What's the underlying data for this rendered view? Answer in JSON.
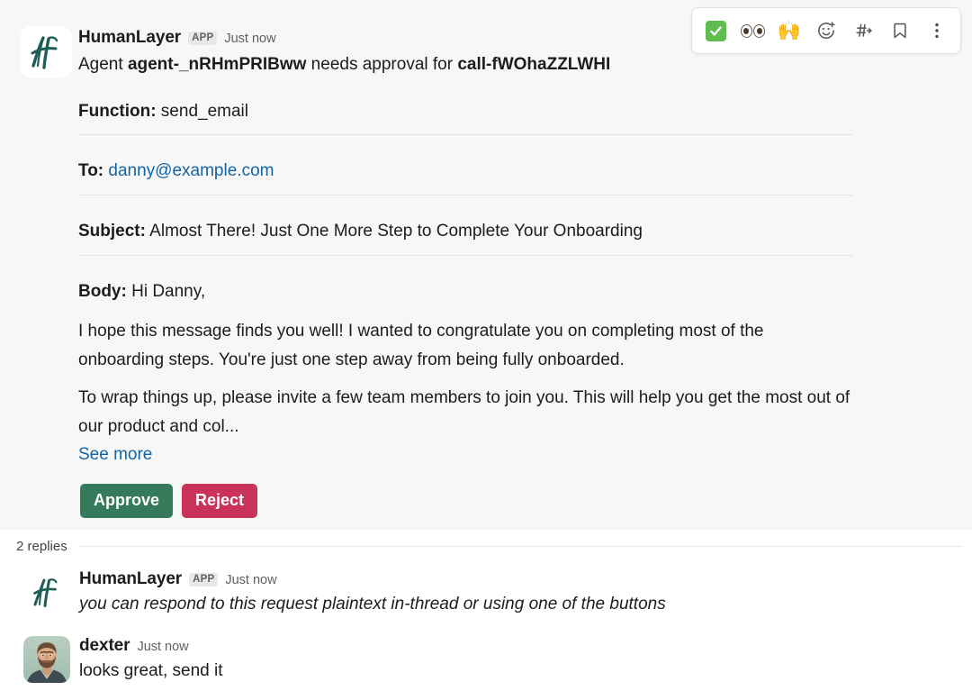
{
  "parent_message": {
    "avatar_name": "humanlayer-logo",
    "sender": "HumanLayer",
    "app_badge": "APP",
    "timestamp": "Just now",
    "headline": {
      "prefix": "Agent ",
      "agent_id": "agent-_nRHmPRIBww",
      "middle": " needs approval for ",
      "call_id": "call-fWOhaZZLWHI"
    },
    "fields": [
      {
        "label": "Function:",
        "value": " send_email",
        "is_link": false
      },
      {
        "label": "To:",
        "value": " danny@example.com",
        "is_link": true
      },
      {
        "label": "Subject:",
        "value": " Almost There! Just One More Step to Complete Your Onboarding",
        "is_link": false
      },
      {
        "label": "Body:",
        "value": " Hi Danny,",
        "is_link": false
      }
    ],
    "body_paragraphs": [
      "I hope this message finds you well! I wanted to congratulate you on completing most of the onboarding steps. You're just one step away from being fully onboarded.",
      "To wrap things up, please invite a few team members to join you. This will help you get the most out of our product and col..."
    ],
    "see_more_label": "See more",
    "buttons": [
      {
        "label": "Approve",
        "color": "#357a5b"
      },
      {
        "label": "Reject",
        "color": "#cb3259"
      }
    ]
  },
  "toolbar": {
    "items": [
      {
        "name": "white-check-mark-reaction",
        "icon": "white-check-mark-emoji"
      },
      {
        "name": "eyes-reaction",
        "icon": "eyes-emoji"
      },
      {
        "name": "raised-hands-reaction",
        "icon": "raised-hands-emoji",
        "glyph": "🙌"
      },
      {
        "name": "add-reaction",
        "icon": "add-reaction-icon"
      },
      {
        "name": "share-message",
        "icon": "share-to-channel-icon"
      },
      {
        "name": "save-message",
        "icon": "bookmark-icon"
      },
      {
        "name": "more-actions",
        "icon": "more-actions-icon"
      }
    ]
  },
  "thread": {
    "replies_count_label": "2 replies",
    "replies": [
      {
        "avatar_name": "humanlayer-logo",
        "sender": "HumanLayer",
        "app_badge": "APP",
        "timestamp": "Just now",
        "text": "you can respond to this request plaintext in-thread or using one of the buttons",
        "italic": true
      },
      {
        "avatar_name": "dexter-avatar",
        "sender": "dexter",
        "app_badge": "",
        "timestamp": "Just now",
        "text": "looks great, send it",
        "italic": false
      }
    ]
  },
  "colors": {
    "hover_background": "#f7f7f7",
    "link": "#1264a3",
    "text": "#1d1c1d",
    "muted_text": "#616061",
    "approve_green": "#357a5b",
    "reject_red": "#cb3259",
    "brand_teal": "#1f5e57"
  }
}
